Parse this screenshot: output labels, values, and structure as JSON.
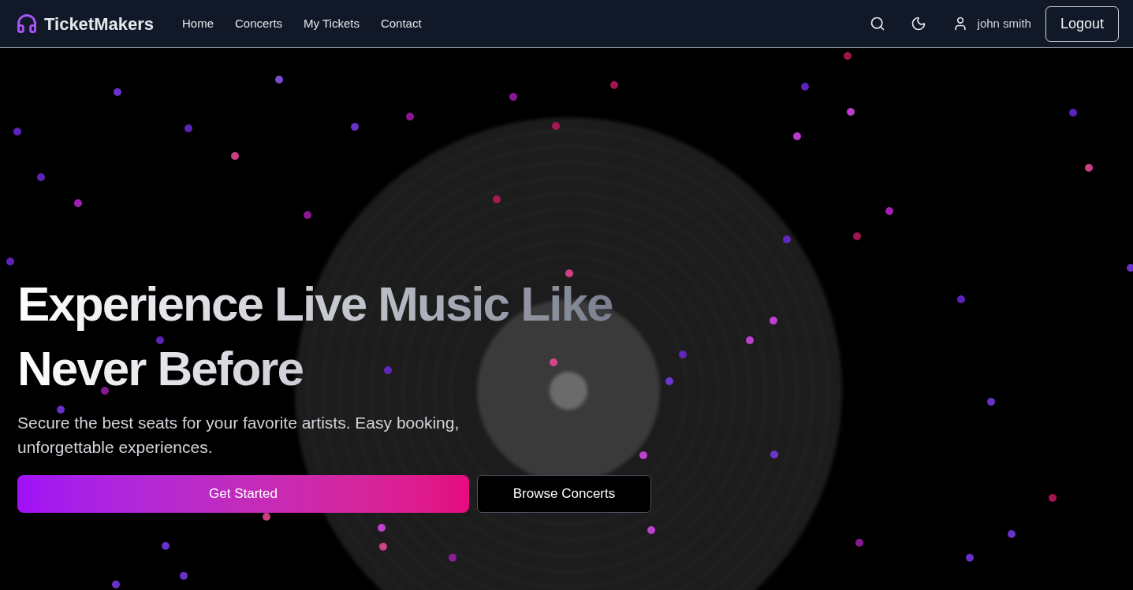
{
  "brand": {
    "name": "TicketMakers"
  },
  "nav": [
    {
      "label": "Home"
    },
    {
      "label": "Concerts"
    },
    {
      "label": "My Tickets"
    },
    {
      "label": "Contact"
    }
  ],
  "user": {
    "name": "john smith"
  },
  "logout": "Logout",
  "hero": {
    "title_line_1": "Experience Live Music Like",
    "title_line_2": "Never Before",
    "subtitle": "Secure the best seats for your favorite artists. Easy booking, unforgettable experiences.",
    "primary_button": "Get Started",
    "secondary_button": "Browse Concerts"
  }
}
